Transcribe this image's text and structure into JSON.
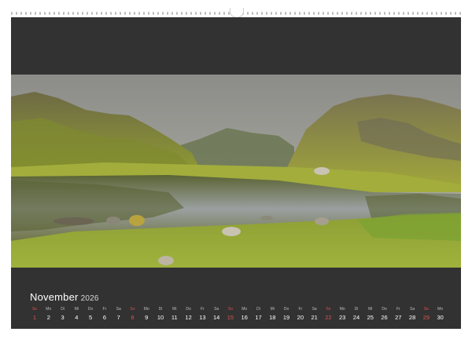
{
  "calendar": {
    "month": "November",
    "year": "2026",
    "days": [
      {
        "n": "1",
        "d": "So",
        "sun": true
      },
      {
        "n": "2",
        "d": "Mo"
      },
      {
        "n": "3",
        "d": "Di"
      },
      {
        "n": "4",
        "d": "Mi"
      },
      {
        "n": "5",
        "d": "Do"
      },
      {
        "n": "6",
        "d": "Fr"
      },
      {
        "n": "7",
        "d": "Sa"
      },
      {
        "n": "8",
        "d": "So",
        "sun": true
      },
      {
        "n": "9",
        "d": "Mo"
      },
      {
        "n": "10",
        "d": "Di"
      },
      {
        "n": "11",
        "d": "Mi"
      },
      {
        "n": "12",
        "d": "Do"
      },
      {
        "n": "13",
        "d": "Fr"
      },
      {
        "n": "14",
        "d": "Sa"
      },
      {
        "n": "15",
        "d": "So",
        "sun": true
      },
      {
        "n": "16",
        "d": "Mo"
      },
      {
        "n": "17",
        "d": "Di"
      },
      {
        "n": "18",
        "d": "Mi"
      },
      {
        "n": "19",
        "d": "Do"
      },
      {
        "n": "20",
        "d": "Fr"
      },
      {
        "n": "21",
        "d": "Sa"
      },
      {
        "n": "22",
        "d": "So",
        "sun": true
      },
      {
        "n": "23",
        "d": "Mo"
      },
      {
        "n": "24",
        "d": "Di"
      },
      {
        "n": "25",
        "d": "Mi"
      },
      {
        "n": "26",
        "d": "Do"
      },
      {
        "n": "27",
        "d": "Fr"
      },
      {
        "n": "28",
        "d": "Sa"
      },
      {
        "n": "29",
        "d": "So",
        "sun": true
      },
      {
        "n": "30",
        "d": "Mo"
      }
    ]
  },
  "colors": {
    "sheet": "#323232",
    "sunday": "#d9534f",
    "text": "#ffffff"
  }
}
